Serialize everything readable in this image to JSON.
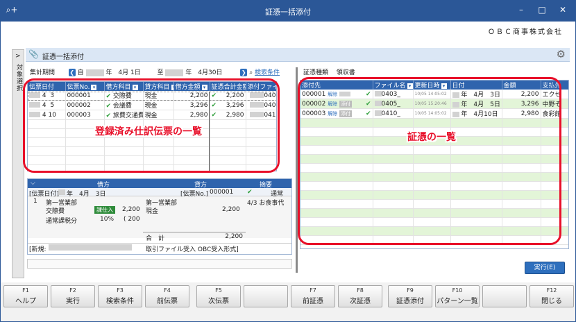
{
  "window": {
    "title": "証憑一括添付",
    "company": "ＯＢＣ商事株式会社"
  },
  "panel": {
    "title": "証憑一括添付"
  },
  "sidebar": {
    "label": "対象選択",
    "arrow": ">"
  },
  "period": {
    "label": "集計期間",
    "from_label": "自",
    "from_date": "年　4月 1日",
    "to_label": "至",
    "to_date": "年　4月30日",
    "search_label": "検索条件"
  },
  "left_grid": {
    "headers": [
      "伝票日付",
      "伝票No.",
      "借方科目",
      "貸方科目",
      "借方金額",
      "証憑合計金額",
      "添付ファイル"
    ],
    "rows": [
      {
        "m": "4",
        "d": "3",
        "no": "000001",
        "debit": "交際費",
        "credit": "現金",
        "amount": "2,200",
        "total": "2,200",
        "file": "040"
      },
      {
        "m": "4",
        "d": "5",
        "no": "000002",
        "debit": "会議費",
        "credit": "現金",
        "amount": "3,296",
        "total": "3,296",
        "file": "040"
      },
      {
        "m": "4",
        "d": "10",
        "no": "000003",
        "debit": "旅費交通費",
        "credit": "現金",
        "amount": "2,980",
        "total": "2,980",
        "file": "041"
      }
    ]
  },
  "annotations": {
    "left": "登録済み仕訳伝票の一覧",
    "right": "証憑の一覧"
  },
  "detail": {
    "debit_header": "借方",
    "credit_header": "貸方",
    "memo_header": "摘要",
    "date_label": "[伝票日付]",
    "date_value": "年　4月　3日",
    "no_label": "[伝票No.]",
    "no_value": "000001",
    "status": "通常",
    "line_no": "1",
    "debit_dept": "第一営業部",
    "debit_account": "交際費",
    "tax_badge": "課仕入",
    "debit_amount": "2,200",
    "tax_label": "通常課税分",
    "tax_rate": "10%",
    "tax_amount": "( 200",
    "credit_dept": "第一営業部",
    "credit_account": "現金",
    "credit_amount": "2,200",
    "memo": "4/3 お食事代",
    "total_label": "合　計",
    "total_value": "2,200",
    "new_label": "[新規:",
    "footer_text": "取引ファイル受入 OBC受入形式]"
  },
  "right_tabs": [
    "証憑種類",
    "領収書"
  ],
  "right_grid": {
    "headers": [
      "添付先",
      "ファイル名",
      "更新日時",
      "日付",
      "金額",
      "支払先"
    ],
    "rows": [
      {
        "dest": "000001",
        "action": "解除",
        "tag": "",
        "file": "0403_",
        "updated": "10/05 14:05:02",
        "date": "年　4月　3日",
        "amount": "2,200",
        "payee": "エクセ"
      },
      {
        "dest": "000002",
        "action": "解除",
        "tag": "添付",
        "file": "0405_",
        "updated": "10/05 15:20:46",
        "date": "年　4月　5日",
        "amount": "3,296",
        "payee": "中野そ"
      },
      {
        "dest": "000003",
        "action": "解除",
        "tag": "添付",
        "file": "0410_",
        "updated": "10/05 14:05:02",
        "date": "年　4月10日",
        "amount": "2,980",
        "payee": "食彩館"
      }
    ]
  },
  "exec_button": "実行(E)",
  "fkeys": [
    {
      "key": "F1",
      "label": "ヘルプ"
    },
    {
      "key": "F2",
      "label": "実行"
    },
    {
      "key": "F3",
      "label": "検索条件"
    },
    {
      "key": "F4",
      "label": "前伝票"
    },
    {
      "key": "F5",
      "label": "次伝票"
    },
    {
      "key": "",
      "label": ""
    },
    {
      "key": "F7",
      "label": "前証憑"
    },
    {
      "key": "F8",
      "label": "次証憑"
    },
    {
      "key": "F9",
      "label": "証憑添付"
    },
    {
      "key": "F10",
      "label": "パターン一覧"
    },
    {
      "key": "",
      "label": ""
    },
    {
      "key": "F12",
      "label": "閉じる"
    }
  ]
}
